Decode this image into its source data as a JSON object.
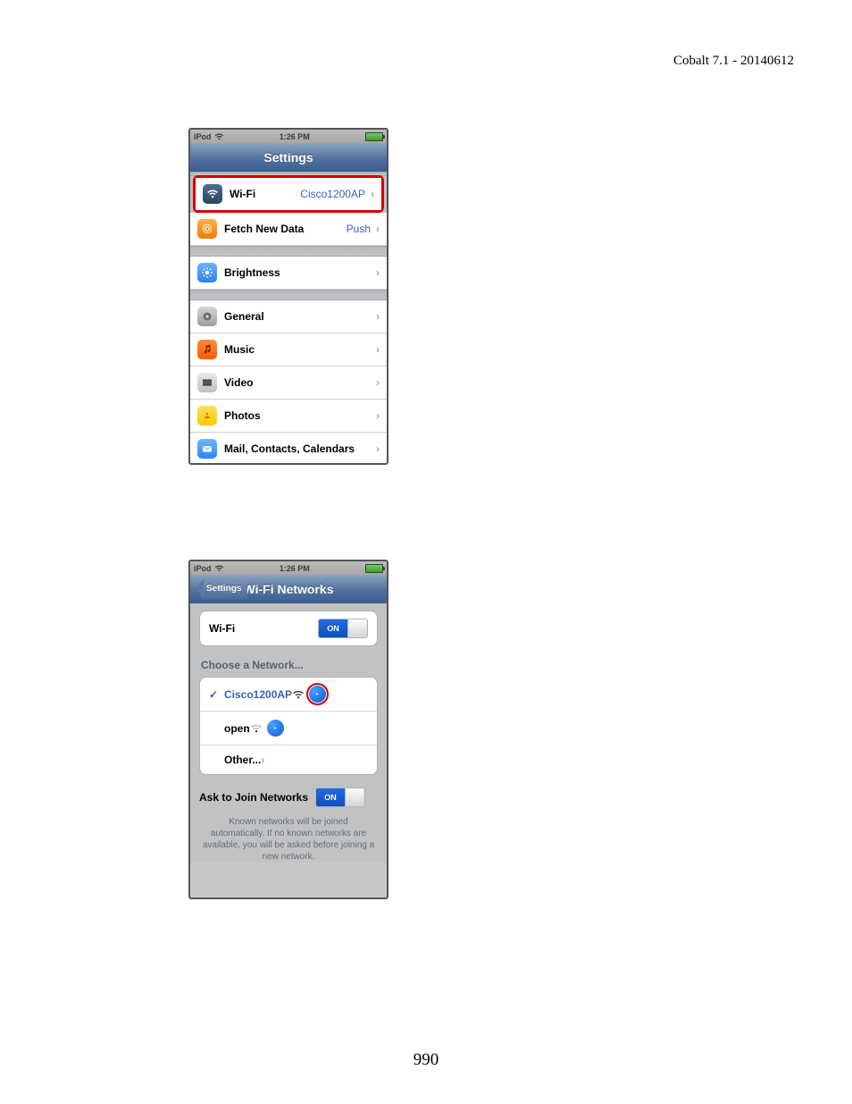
{
  "doc": {
    "header": "Cobalt 7.1 - 20140612",
    "page_number": "990"
  },
  "status": {
    "device": "iPod",
    "time": "1:26 PM"
  },
  "screen1": {
    "title": "Settings",
    "rows": {
      "wifi": {
        "label": "Wi-Fi",
        "value": "Cisco1200AP"
      },
      "fetch": {
        "label": "Fetch New Data",
        "value": "Push"
      },
      "bright": {
        "label": "Brightness"
      },
      "general": {
        "label": "General"
      },
      "music": {
        "label": "Music"
      },
      "video": {
        "label": "Video"
      },
      "photos": {
        "label": "Photos"
      },
      "mail": {
        "label": "Mail, Contacts, Calendars"
      }
    }
  },
  "screen2": {
    "back": "Settings",
    "title": "Wi-Fi Networks",
    "wifi_label": "Wi-Fi",
    "toggle_on": "ON",
    "choose_label": "Choose a Network...",
    "networks": {
      "n0": {
        "name": "Cisco1200AP"
      },
      "n1": {
        "name": "open"
      },
      "other": {
        "name": "Other..."
      }
    },
    "ask_label": "Ask to Join Networks",
    "ask_toggle": "ON",
    "footer": "Known networks will be joined automatically. If no known networks are available, you will be asked before joining a new network."
  }
}
